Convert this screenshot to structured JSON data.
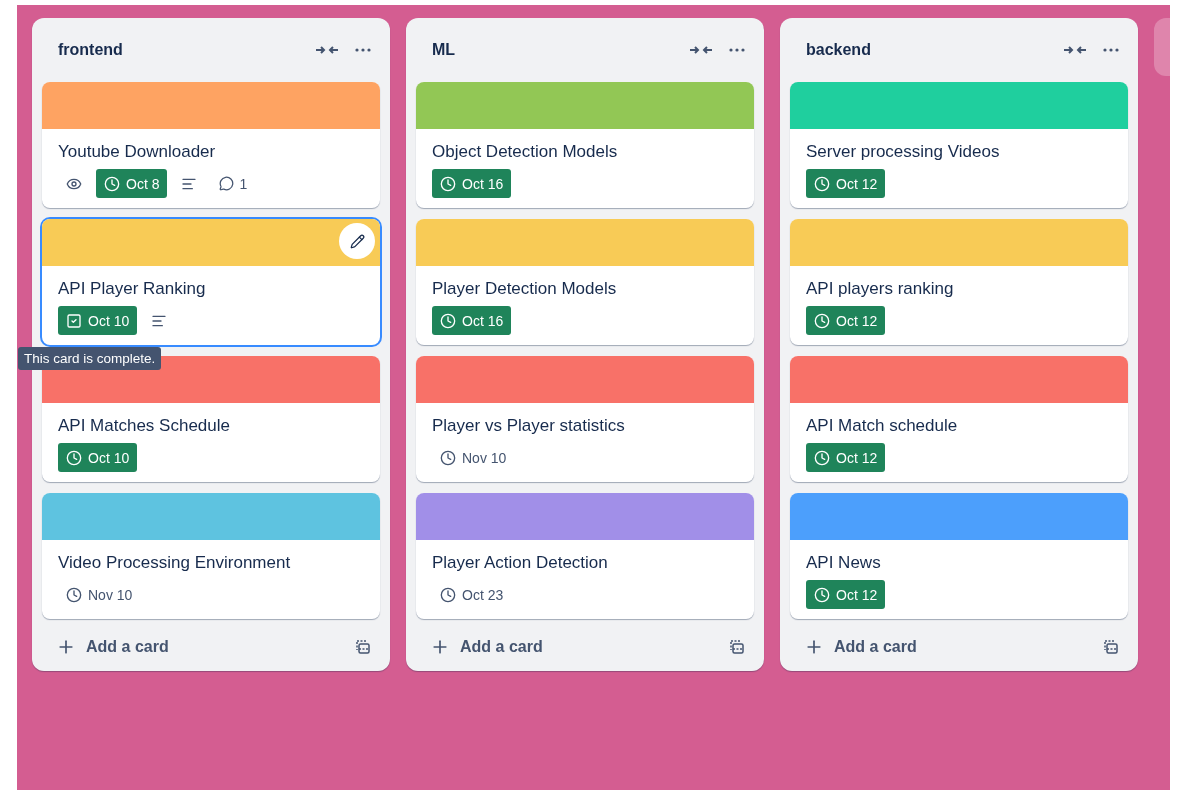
{
  "lists": [
    {
      "title": "frontend",
      "cards": [
        {
          "color": "#fea362",
          "title": "Youtube Downloader",
          "hovered": false,
          "badges": [
            {
              "kind": "watch"
            },
            {
              "kind": "due",
              "text": "Oct 8",
              "complete": true
            },
            {
              "kind": "description"
            },
            {
              "kind": "comments",
              "text": "1"
            }
          ]
        },
        {
          "color": "#f8cb56",
          "title": "API Player Ranking",
          "hovered": true,
          "tooltip": "This card is complete.",
          "badges": [
            {
              "kind": "due",
              "text": "Oct 10",
              "complete": true
            },
            {
              "kind": "description"
            }
          ]
        },
        {
          "color": "#f87168",
          "title": "API Matches Schedule",
          "hovered": false,
          "badges": [
            {
              "kind": "due",
              "text": "Oct 10",
              "complete": true
            }
          ]
        },
        {
          "color": "#5ec3e0",
          "title": "Video Processing Environment",
          "hovered": false,
          "badges": [
            {
              "kind": "due",
              "text": "Nov 10",
              "complete": false
            }
          ]
        }
      ],
      "add_label": "Add a card"
    },
    {
      "title": "ML",
      "cards": [
        {
          "color": "#92c755",
          "title": "Object Detection Models",
          "hovered": false,
          "badges": [
            {
              "kind": "due",
              "text": "Oct 16",
              "complete": true
            }
          ]
        },
        {
          "color": "#f8cb56",
          "title": "Player Detection Models",
          "hovered": false,
          "badges": [
            {
              "kind": "due",
              "text": "Oct 16",
              "complete": true
            }
          ]
        },
        {
          "color": "#f87168",
          "title": "Player vs Player statistics",
          "hovered": false,
          "badges": [
            {
              "kind": "due",
              "text": "Nov 10",
              "complete": false
            }
          ]
        },
        {
          "color": "#a18fe8",
          "title": "Player Action Detection",
          "hovered": false,
          "badges": [
            {
              "kind": "due",
              "text": "Oct 23",
              "complete": false
            }
          ]
        }
      ],
      "add_label": "Add a card"
    },
    {
      "title": "backend",
      "cards": [
        {
          "color": "#1fcf9e",
          "title": "Server processing Videos",
          "hovered": false,
          "badges": [
            {
              "kind": "due",
              "text": "Oct 12",
              "complete": true
            }
          ]
        },
        {
          "color": "#f8cb56",
          "title": "API players ranking",
          "hovered": false,
          "badges": [
            {
              "kind": "due",
              "text": "Oct 12",
              "complete": true
            }
          ]
        },
        {
          "color": "#f87168",
          "title": "API Match schedule",
          "hovered": false,
          "badges": [
            {
              "kind": "due",
              "text": "Oct 12",
              "complete": true
            }
          ]
        },
        {
          "color": "#4c9ffc",
          "title": "API News",
          "hovered": false,
          "badges": [
            {
              "kind": "due",
              "text": "Oct 12",
              "complete": true
            }
          ]
        }
      ],
      "add_label": "Add a card"
    }
  ]
}
